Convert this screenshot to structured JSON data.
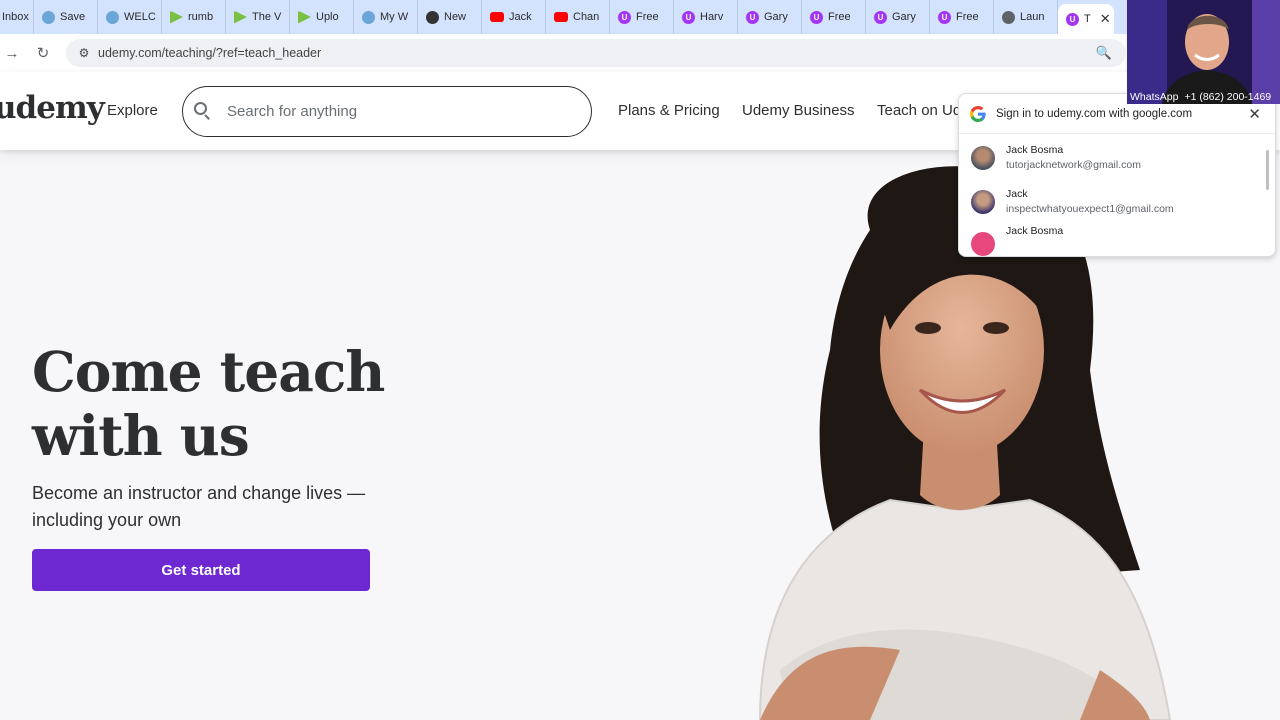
{
  "browser": {
    "tabs": [
      {
        "label": "Inbox",
        "icon": "mail-icon"
      },
      {
        "label": "Save",
        "icon": "bird-icon"
      },
      {
        "label": "WELC",
        "icon": "bird-icon"
      },
      {
        "label": "rumb",
        "icon": "rumble-play-icon"
      },
      {
        "label": "The V",
        "icon": "rumble-play-icon"
      },
      {
        "label": "Uplo",
        "icon": "rumble-play-icon"
      },
      {
        "label": "My W",
        "icon": "bird-icon"
      },
      {
        "label": "New",
        "icon": "github-icon"
      },
      {
        "label": "Jack",
        "icon": "youtube-icon"
      },
      {
        "label": "Chan",
        "icon": "youtube-icon"
      },
      {
        "label": "Free",
        "icon": "udemy-icon"
      },
      {
        "label": "Harv",
        "icon": "udemy-icon"
      },
      {
        "label": "Gary",
        "icon": "udemy-icon"
      },
      {
        "label": "Free",
        "icon": "udemy-icon"
      },
      {
        "label": "Gary",
        "icon": "udemy-icon"
      },
      {
        "label": "Free",
        "icon": "udemy-icon"
      },
      {
        "label": "Laun",
        "icon": "globe-icon"
      },
      {
        "label": "T",
        "icon": "udemy-icon",
        "active": true
      }
    ],
    "url": "udemy.com/teaching/?ref=teach_header"
  },
  "header": {
    "logo": "udemy",
    "explore": "Explore",
    "search_placeholder": "Search for anything",
    "nav": {
      "plans": "Plans & Pricing",
      "business": "Udemy Business",
      "teach": "Teach on Ud"
    }
  },
  "hero": {
    "title_line1": "Come teach",
    "title_line2": "with us",
    "subtitle": "Become an instructor and change lives — including your own",
    "cta": "Get started"
  },
  "google_signin": {
    "title": "Sign in to udemy.com with google.com",
    "accounts": [
      {
        "name": "Jack Bosma",
        "email": "tutorjacknetwork@gmail.com"
      },
      {
        "name": "Jack",
        "email": "inspectwhatyouexpect1@gmail.com"
      },
      {
        "name": "Jack Bosma",
        "email": ""
      }
    ]
  },
  "webcam": {
    "app": "WhatsApp",
    "phone": "+1 (862) 200-1469"
  },
  "colors": {
    "brand_purple": "#6d28d2",
    "tab_strip": "#d3e3fd",
    "text_dark": "#2d2f31"
  }
}
